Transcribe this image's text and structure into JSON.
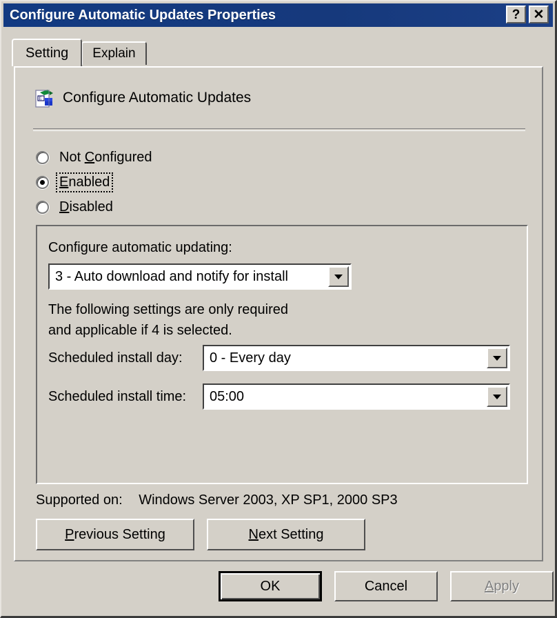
{
  "window": {
    "title": "Configure Automatic Updates Properties",
    "help_button": "?",
    "close_button": "✕",
    "title_bar_color": "#16397c",
    "face_color": "#d4d0c8"
  },
  "tabs": [
    {
      "label": "Setting",
      "active": true
    },
    {
      "label": "Explain",
      "active": false
    }
  ],
  "policy": {
    "icon": "group-policy-icon",
    "title": "Configure Automatic Updates"
  },
  "state_options": [
    {
      "label": "Not Configured",
      "mnemonic_pre": "Not ",
      "mnemonic": "C",
      "mnemonic_post": "onfigured",
      "selected": false,
      "focused": false
    },
    {
      "label": "Enabled",
      "mnemonic_pre": "",
      "mnemonic": "E",
      "mnemonic_post": "nabled",
      "selected": true,
      "focused": true
    },
    {
      "label": "Disabled",
      "mnemonic_pre": "",
      "mnemonic": "D",
      "mnemonic_post": "isabled",
      "selected": false,
      "focused": false
    }
  ],
  "settings": {
    "configure_label": "Configure automatic updating:",
    "configure_value": "3 - Auto download and notify for install",
    "hint_line_1": "The following settings are only required",
    "hint_line_2": "and applicable if 4 is selected.",
    "install_day_label": "Scheduled install day:",
    "install_day_value": "0 - Every day",
    "install_time_label": "Scheduled install time:",
    "install_time_value": "05:00"
  },
  "supported": {
    "label": "Supported on:",
    "value": "Windows Server 2003, XP SP1, 2000 SP3"
  },
  "nav_buttons": {
    "previous": {
      "pre": "",
      "mnemonic": "P",
      "post": "revious Setting"
    },
    "next": {
      "pre": "",
      "mnemonic": "N",
      "post": "ext Setting"
    }
  },
  "bottom_buttons": [
    {
      "label": "OK",
      "default": true,
      "enabled": true
    },
    {
      "label": "Cancel",
      "default": false,
      "enabled": true
    },
    {
      "label": "Apply",
      "default": false,
      "enabled": false,
      "mnemonic": "A",
      "post": "pply"
    }
  ]
}
